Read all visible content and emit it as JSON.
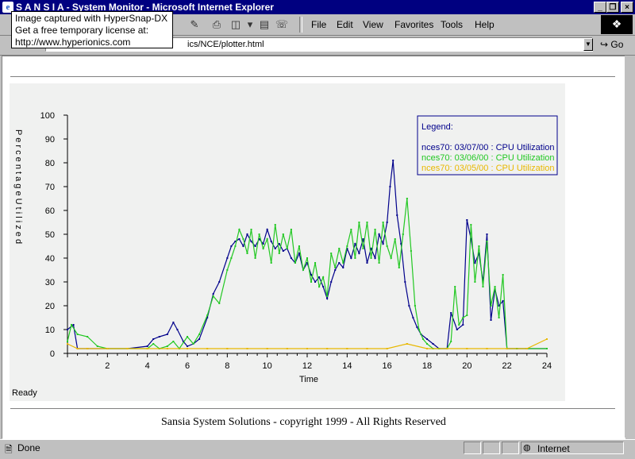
{
  "window": {
    "title": "S A N S I A - System Monitor - Microsoft Internet Explorer",
    "minimize_glyph": "_",
    "restore_glyph": "❐",
    "close_glyph": "×"
  },
  "menu": {
    "items": [
      {
        "label": "File"
      },
      {
        "label": "Edit"
      },
      {
        "label": "View"
      },
      {
        "label": "Favorites"
      },
      {
        "label": "Tools"
      },
      {
        "label": "Help"
      }
    ]
  },
  "address": {
    "visible_text": "ics/NCE/plotter.html",
    "go_label": "Go"
  },
  "capture_popup": {
    "line1": "Image captured with HyperSnap-DX",
    "line2": "Get a free temporary license at:",
    "line3": "http://www.hyperionics.com"
  },
  "page": {
    "status_text": "Ready",
    "footer": "Sansia System Solutions - copyright 1999 - All Rights Reserved"
  },
  "status": {
    "left": "Done",
    "zone": "Internet"
  },
  "colors": {
    "series1": "#00008b",
    "series2": "#22c822",
    "series3": "#e8b800",
    "chart_bg": "#f0f0f0",
    "title_bar": "#000080"
  },
  "chart_data": {
    "type": "line",
    "xlabel": "Time",
    "ylabel": "P e r c e n t a g e   U t i l i z e d",
    "xlim": [
      0,
      24
    ],
    "ylim": [
      0,
      100
    ],
    "x_ticks": [
      2,
      4,
      6,
      8,
      10,
      12,
      14,
      16,
      18,
      20,
      22,
      24
    ],
    "y_ticks": [
      0,
      10,
      20,
      30,
      40,
      50,
      60,
      70,
      80,
      90,
      100
    ],
    "legend_title": "Legend:",
    "legend_position": "top-right",
    "series": [
      {
        "name": "nces70: 03/07/00 : CPU Utilization",
        "color": "#00008b",
        "x": [
          0,
          0.3,
          0.5,
          1,
          2,
          3,
          4,
          4.3,
          4.6,
          5,
          5.3,
          5.5,
          5.8,
          6,
          6.3,
          6.6,
          7,
          7.3,
          7.6,
          8,
          8.2,
          8.4,
          8.6,
          8.8,
          9,
          9.2,
          9.4,
          9.6,
          9.8,
          10,
          10.2,
          10.4,
          10.6,
          10.8,
          11,
          11.2,
          11.4,
          11.6,
          11.8,
          12,
          12.2,
          12.4,
          12.6,
          12.8,
          13,
          13.2,
          13.4,
          13.6,
          13.8,
          14,
          14.2,
          14.4,
          14.6,
          14.8,
          15,
          15.2,
          15.4,
          15.6,
          15.8,
          16,
          16.15,
          16.3,
          16.5,
          16.7,
          16.9,
          17.1,
          17.3,
          17.5,
          17.7,
          18,
          18.3,
          18.6,
          19,
          19.2,
          19.5,
          19.8,
          20,
          20.2,
          20.4,
          20.6,
          20.8,
          21,
          21.2,
          21.4,
          21.6,
          21.8,
          22,
          22.5,
          23,
          24
        ],
        "y": [
          10,
          12,
          2,
          2,
          2,
          2,
          3,
          6,
          7,
          8,
          13,
          10,
          5,
          3,
          4,
          6,
          15,
          25,
          30,
          40,
          45,
          47,
          48,
          45,
          50,
          47,
          45,
          48,
          46,
          52,
          47,
          44,
          46,
          43,
          44,
          40,
          38,
          42,
          35,
          38,
          33,
          30,
          32,
          28,
          23,
          30,
          35,
          38,
          36,
          44,
          40,
          46,
          42,
          48,
          38,
          44,
          40,
          50,
          46,
          55,
          70,
          81,
          58,
          46,
          30,
          20,
          15,
          11,
          8,
          6,
          4,
          2,
          2,
          17,
          10,
          12,
          56,
          48,
          38,
          42,
          30,
          50,
          14,
          27,
          20,
          22,
          2,
          2,
          2,
          2
        ]
      },
      {
        "name": "nces70: 03/06/00 : CPU Utilization",
        "color": "#22c822",
        "x": [
          0,
          0.2,
          0.5,
          1,
          1.5,
          2,
          3,
          4,
          4.3,
          4.6,
          5,
          5.3,
          5.6,
          6,
          6.3,
          6.6,
          7,
          7.3,
          7.6,
          8,
          8.2,
          8.4,
          8.6,
          8.8,
          9,
          9.2,
          9.4,
          9.6,
          9.8,
          10,
          10.2,
          10.4,
          10.6,
          10.8,
          11,
          11.2,
          11.4,
          11.6,
          11.8,
          12,
          12.2,
          12.4,
          12.6,
          12.8,
          13,
          13.2,
          13.4,
          13.6,
          13.8,
          14,
          14.2,
          14.4,
          14.6,
          14.8,
          15,
          15.2,
          15.4,
          15.6,
          15.8,
          16,
          16.2,
          16.4,
          16.6,
          16.8,
          17,
          17.2,
          17.4,
          17.6,
          17.8,
          18,
          18.3,
          18.6,
          19,
          19.2,
          19.4,
          19.6,
          19.8,
          20,
          20.2,
          20.4,
          20.6,
          20.8,
          21,
          21.2,
          21.4,
          21.6,
          21.8,
          22,
          22.5,
          23,
          24
        ],
        "y": [
          5,
          12,
          8,
          7,
          3,
          2,
          2,
          2,
          4,
          2,
          3,
          5,
          2,
          7,
          4,
          8,
          16,
          24,
          21,
          35,
          40,
          45,
          52,
          48,
          42,
          52,
          40,
          50,
          44,
          48,
          38,
          54,
          42,
          50,
          44,
          52,
          38,
          45,
          35,
          40,
          30,
          38,
          28,
          32,
          24,
          42,
          36,
          44,
          38,
          45,
          52,
          40,
          55,
          44,
          55,
          40,
          52,
          38,
          55,
          45,
          40,
          48,
          36,
          50,
          65,
          43,
          20,
          10,
          6,
          4,
          2,
          2,
          2,
          5,
          28,
          12,
          15,
          16,
          54,
          30,
          45,
          28,
          47,
          20,
          28,
          15,
          33,
          2,
          2,
          2,
          2
        ]
      },
      {
        "name": "nces70: 03/05/00 : CPU Utilization",
        "color": "#e8b800",
        "x": [
          0,
          0.5,
          1,
          2,
          3,
          4,
          5,
          6,
          7,
          8,
          9,
          10,
          11,
          12,
          13,
          14,
          15,
          16,
          17,
          18,
          19,
          20,
          21,
          22,
          23,
          24
        ],
        "y": [
          4,
          2,
          2,
          2,
          2,
          2,
          2,
          2,
          2,
          2,
          2,
          2,
          2,
          2,
          2,
          2,
          2,
          2,
          4,
          2,
          2,
          2,
          2,
          2,
          2,
          6
        ]
      }
    ]
  }
}
